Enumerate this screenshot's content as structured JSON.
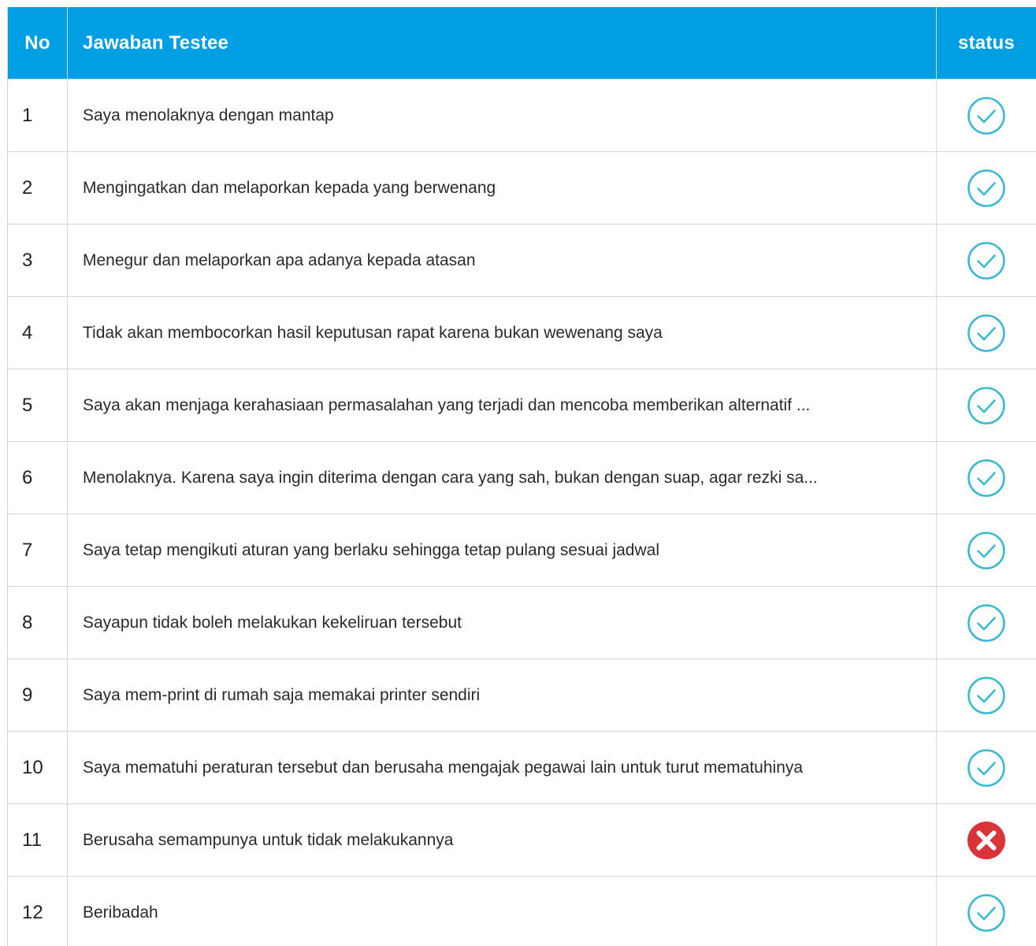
{
  "header": {
    "no": "No",
    "answer": "Jawaban Testee",
    "status": "status"
  },
  "colors": {
    "header_bg": "#009ee2",
    "check": "#3bb9cf",
    "cross": "#d9343a"
  },
  "rows": [
    {
      "no": "1",
      "answer": "Saya menolaknya dengan mantap",
      "status": "correct",
      "icon": "check-circle-icon"
    },
    {
      "no": "2",
      "answer": "Mengingatkan dan melaporkan kepada yang berwenang",
      "status": "correct",
      "icon": "check-circle-icon"
    },
    {
      "no": "3",
      "answer": "Menegur dan melaporkan apa adanya kepada atasan",
      "status": "correct",
      "icon": "check-circle-icon"
    },
    {
      "no": "4",
      "answer": "Tidak akan membocorkan hasil keputusan rapat karena bukan wewenang saya",
      "status": "correct",
      "icon": "check-circle-icon"
    },
    {
      "no": "5",
      "answer": "Saya akan menjaga kerahasiaan permasalahan yang terjadi dan mencoba memberikan alternatif ...",
      "status": "correct",
      "icon": "check-circle-icon"
    },
    {
      "no": "6",
      "answer": "Menolaknya. Karena saya ingin diterima dengan cara yang sah, bukan dengan suap, agar rezki sa...",
      "status": "correct",
      "icon": "check-circle-icon"
    },
    {
      "no": "7",
      "answer": "Saya tetap mengikuti aturan yang berlaku sehingga tetap pulang sesuai jadwal",
      "status": "correct",
      "icon": "check-circle-icon"
    },
    {
      "no": "8",
      "answer": "Sayapun tidak boleh melakukan kekeliruan tersebut",
      "status": "correct",
      "icon": "check-circle-icon"
    },
    {
      "no": "9",
      "answer": "Saya mem-print di rumah saja memakai printer sendiri",
      "status": "correct",
      "icon": "check-circle-icon"
    },
    {
      "no": "10",
      "answer": "Saya mematuhi peraturan tersebut dan berusaha mengajak pegawai lain untuk turut mematuhinya",
      "status": "correct",
      "icon": "check-circle-icon"
    },
    {
      "no": "11",
      "answer": "Berusaha semampunya untuk tidak melakukannya",
      "status": "wrong",
      "icon": "x-circle-icon"
    },
    {
      "no": "12",
      "answer": "Beribadah",
      "status": "correct",
      "icon": "check-circle-icon"
    }
  ]
}
